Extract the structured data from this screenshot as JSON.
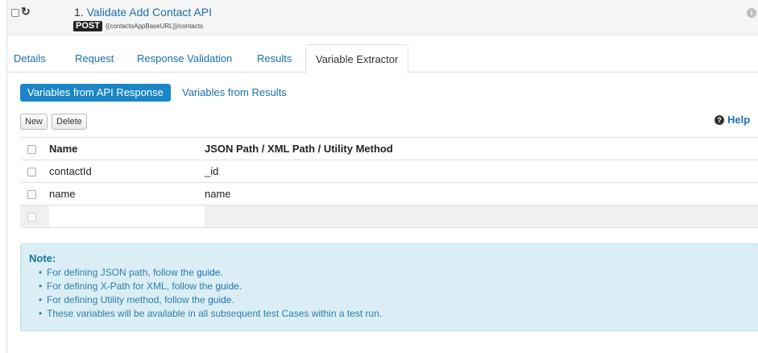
{
  "header": {
    "refresh_icon": "↻",
    "test_number": "1.",
    "test_title": "Validate Add Contact API",
    "method": "POST",
    "url": "{{contactsAppBaseURL}}/contacts"
  },
  "tabs": [
    {
      "label": "Details"
    },
    {
      "label": "Request"
    },
    {
      "label": "Response Validation"
    },
    {
      "label": "Results"
    },
    {
      "label": "Variable Extractor"
    }
  ],
  "subtabs": [
    {
      "label": "Variables from API Response"
    },
    {
      "label": "Variables from Results"
    }
  ],
  "toolbar": {
    "new_label": "New",
    "delete_label": "Delete",
    "help_label": "Help"
  },
  "table": {
    "headers": [
      "Name",
      "JSON Path / XML Path / Utility Method"
    ],
    "rows": [
      {
        "name": "contactId",
        "path": "_id"
      },
      {
        "name": "name",
        "path": "name"
      }
    ]
  },
  "note": {
    "title": "Note:",
    "items": [
      {
        "text": "For defining JSON path, follow the ",
        "link": "guide",
        "suffix": "."
      },
      {
        "text": "For defining X-Path for XML, follow the ",
        "link": "guide",
        "suffix": "."
      },
      {
        "text": "For defining Utility method, follow the ",
        "link": "guide",
        "suffix": "."
      },
      {
        "text": "These variables will be available in all subsequent test Cases within a test run.",
        "link": "",
        "suffix": ""
      }
    ]
  },
  "colors": {
    "accent": "#1a86c8",
    "link": "#1a6fb0",
    "note_bg": "#dbeef6"
  }
}
